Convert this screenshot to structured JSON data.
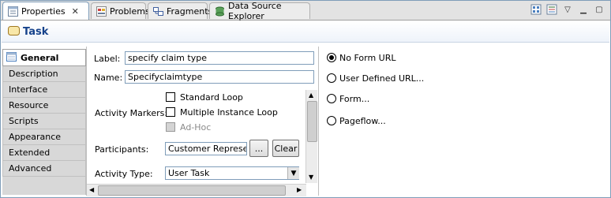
{
  "tabs": [
    {
      "label": "Properties",
      "icon": "properties-icon",
      "active": true,
      "closable": true
    },
    {
      "label": "Problems",
      "icon": "problems-icon"
    },
    {
      "label": "Fragments",
      "icon": "fragments-icon"
    },
    {
      "label": "Data Source Explorer",
      "icon": "data-source-icon"
    }
  ],
  "header": {
    "title": "Task"
  },
  "nav": {
    "items": [
      "General",
      "Description",
      "Interface",
      "Resource",
      "Scripts",
      "Appearance",
      "Extended",
      "Advanced"
    ],
    "active": "General"
  },
  "form": {
    "label_label": "Label:",
    "label_value": "specify claim type",
    "name_label": "Name:",
    "name_value": "Specifyclaimtype",
    "markers_label": "Activity Markers:",
    "markers": [
      {
        "label": "Standard Loop",
        "checked": false,
        "enabled": true
      },
      {
        "label": "Multiple Instance Loop",
        "checked": false,
        "enabled": true
      },
      {
        "label": "Ad-Hoc",
        "checked": false,
        "enabled": false
      }
    ],
    "participants_label": "Participants:",
    "participants_value": "Customer Represent",
    "browse_label": "...",
    "clear_label": "Clear",
    "type_label": "Activity Type:",
    "type_value": "User Task"
  },
  "form_options": [
    {
      "label": "No Form URL",
      "selected": true
    },
    {
      "label": "User Defined URL...",
      "selected": false
    },
    {
      "label": "Form...",
      "selected": false
    },
    {
      "label": "Pageflow...",
      "selected": false
    }
  ],
  "colors": {
    "title": "#15428b",
    "border": "#7f9db9"
  }
}
